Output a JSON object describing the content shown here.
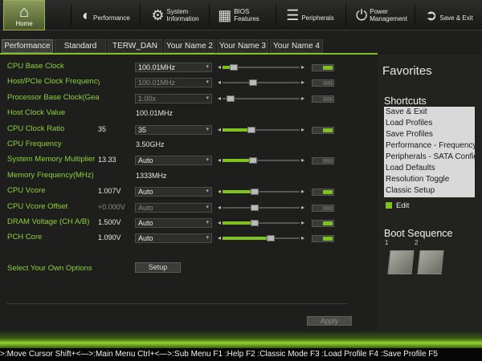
{
  "nav": {
    "items": [
      {
        "label": "Home",
        "icon": "home-icon"
      },
      {
        "label": "Performance",
        "icon": "gauge-icon"
      },
      {
        "label": "System Information",
        "line1": "System",
        "line2": "Information",
        "icon": "gear-icon"
      },
      {
        "label": "BIOS Features",
        "line1": "BIOS",
        "line2": "Features",
        "icon": "chip-icon"
      },
      {
        "label": "Peripherals",
        "icon": "peripherals-icon"
      },
      {
        "label": "Power Management",
        "line1": "Power",
        "line2": "Management",
        "icon": "power-icon"
      },
      {
        "label": "Save & Exit",
        "icon": "exit-icon"
      }
    ]
  },
  "tabs": [
    "Performance",
    "Standard",
    "TERW_DAN",
    "Your Name 2",
    "Your Name 3",
    "Your Name 4"
  ],
  "settings": [
    {
      "label": "CPU Base Clock",
      "select": "100.01MHz",
      "disabled": false,
      "slider": 0.15,
      "toggle": true
    },
    {
      "label": "Host/PCIe Clock Frequency",
      "select": "100.01MHz",
      "disabled": true,
      "slider": 0.4,
      "toggle": false
    },
    {
      "label": "Processor Base Clock(Gear Ratio)",
      "select": "1.00x",
      "disabled": true,
      "slider": 0.1,
      "toggle": false
    },
    {
      "label": "Host Clock Value",
      "value": "100.01MHz"
    },
    {
      "label": "CPU Clock Ratio",
      "current": "35",
      "select": "35",
      "disabled": false,
      "slider": 0.38,
      "toggle": true
    },
    {
      "label": "CPU Frequency",
      "value": "3.50GHz"
    },
    {
      "label": "System Memory Multiplier",
      "current": "13.33",
      "select": "Auto",
      "disabled": false,
      "slider": 0.4,
      "toggle": false
    },
    {
      "label": "Memory Frequency(MHz)",
      "value": "1333MHz"
    },
    {
      "label": "CPU Vcore",
      "current": "1.007V",
      "select": "Auto",
      "disabled": false,
      "slider": 0.42,
      "toggle": true
    },
    {
      "label": "CPU Vcore Offset",
      "current": "+0.000V",
      "select": "Auto",
      "disabled": true,
      "slider": 0.42,
      "toggle": false
    },
    {
      "label": "DRAM Voltage     (CH A/B)",
      "current": "1.500V",
      "select": "Auto",
      "disabled": false,
      "slider": 0.42,
      "toggle": true
    },
    {
      "label": "PCH Core",
      "current": "1.090V",
      "select": "Auto",
      "disabled": false,
      "slider": 0.62,
      "toggle": true
    }
  ],
  "custom_options": {
    "label": "Select Your Own Options",
    "button": "Setup"
  },
  "apply_label": "Apply",
  "favorites": {
    "title": "Favorites",
    "shortcuts_title": "Shortcuts",
    "shortcuts": [
      "Save & Exit",
      "Load Profiles",
      "Save Profiles",
      "Performance - Frequency",
      "Peripherals - SATA Configuration",
      "Load Defaults",
      "Resolution Toggle",
      "Classic Setup"
    ],
    "edit_label": "Edit"
  },
  "boot": {
    "title": "Boot Sequence",
    "items": [
      "1",
      "2"
    ]
  },
  "status_bar": ">:Move Cursor Shift+<—>:Main Menu Ctrl+<—>:Sub Menu F1 :Help F2 :Classic Mode F3 :Load Profile F4 :Save Profile F5",
  "colors": {
    "accent": "#7fc11e",
    "label": "#8ed13a",
    "background": "#1e1f1d"
  }
}
